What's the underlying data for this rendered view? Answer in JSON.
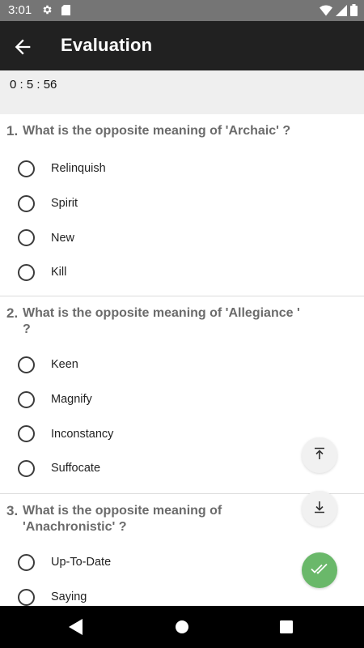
{
  "status_bar": {
    "time": "3:01",
    "icons": [
      "gear-icon",
      "sd-card-icon",
      "wifi-icon",
      "signal-icon",
      "battery-icon"
    ]
  },
  "app_bar": {
    "title": "Evaluation",
    "back_icon": "arrow-back-icon"
  },
  "timer": {
    "text": "0 : 5 : 56"
  },
  "questions": [
    {
      "number": "1.",
      "text": "What is the opposite meaning of 'Archaic' ?",
      "options": [
        "Relinquish",
        "Spirit",
        "New",
        "Kill"
      ]
    },
    {
      "number": "2.",
      "text": "What is the opposite meaning of 'Allegiance ' ?",
      "options": [
        "Keen",
        "Magnify",
        "Inconstancy",
        "Suffocate"
      ]
    },
    {
      "number": "3.",
      "text": "What is the opposite meaning of 'Anachronistic' ?",
      "options": [
        "Up-To-Date",
        "Saying"
      ]
    }
  ],
  "floating_actions": {
    "scroll_top_icon": "scroll-to-top-icon",
    "scroll_bottom_icon": "scroll-to-bottom-icon",
    "submit_icon": "double-check-icon",
    "submit_color": "#6ab86a"
  },
  "nav_bar": {
    "icons": [
      "nav-back-icon",
      "nav-home-icon",
      "nav-recents-icon"
    ]
  }
}
